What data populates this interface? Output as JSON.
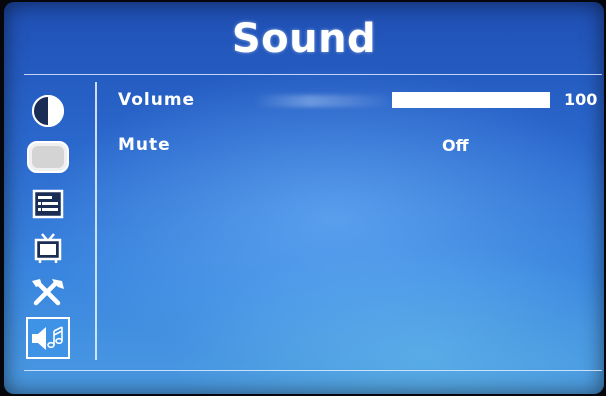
{
  "header": {
    "title": "Sound"
  },
  "sidebar": {
    "items": [
      {
        "icon": "brightness-contrast-icon",
        "selected": false
      },
      {
        "icon": "screen-image-icon",
        "selected": false
      },
      {
        "icon": "osd-menu-icon",
        "selected": false
      },
      {
        "icon": "tv-icon",
        "selected": false
      },
      {
        "icon": "tools-icon",
        "selected": false
      },
      {
        "icon": "speaker-music-icon",
        "selected": true
      }
    ]
  },
  "settings": {
    "volume": {
      "label": "Volume",
      "value": "100",
      "level_percent": 100
    },
    "mute": {
      "label": "Mute",
      "value": "Off"
    }
  },
  "colors": {
    "background_top": "#1f4fb4",
    "background_bottom": "#4a9ae2",
    "selected_icon_bg": "#3e93e6",
    "text": "#ffffff"
  }
}
